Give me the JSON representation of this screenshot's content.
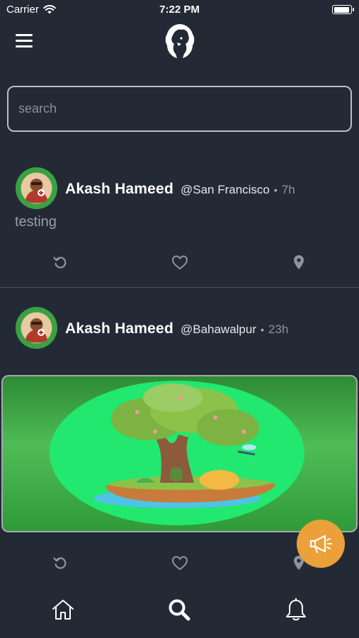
{
  "status_bar": {
    "carrier": "Carrier",
    "time": "7:22 PM"
  },
  "header": {
    "menu_icon": "hamburger-menu-icon",
    "logo": "lion-logo"
  },
  "search": {
    "placeholder": "search",
    "value": ""
  },
  "posts": [
    {
      "author": "Akash Hameed",
      "location": "@San Francisco",
      "separator": "•",
      "time": "7h",
      "text": "testing",
      "actions": [
        "repost-icon",
        "heart-icon",
        "location-pin-icon"
      ]
    },
    {
      "author": "Akash Hameed",
      "location": "@Bahawalpur",
      "separator": "•",
      "time": "23h",
      "image": "tree-island-illustration",
      "actions": [
        "repost-icon",
        "heart-icon",
        "location-pin-icon"
      ]
    }
  ],
  "fab": {
    "icon": "megaphone-icon",
    "color": "#eba03a"
  },
  "tab_bar": {
    "items": [
      "home-icon",
      "search-icon",
      "bell-icon"
    ]
  },
  "colors": {
    "background": "#232a36",
    "accent": "#eba03a"
  }
}
